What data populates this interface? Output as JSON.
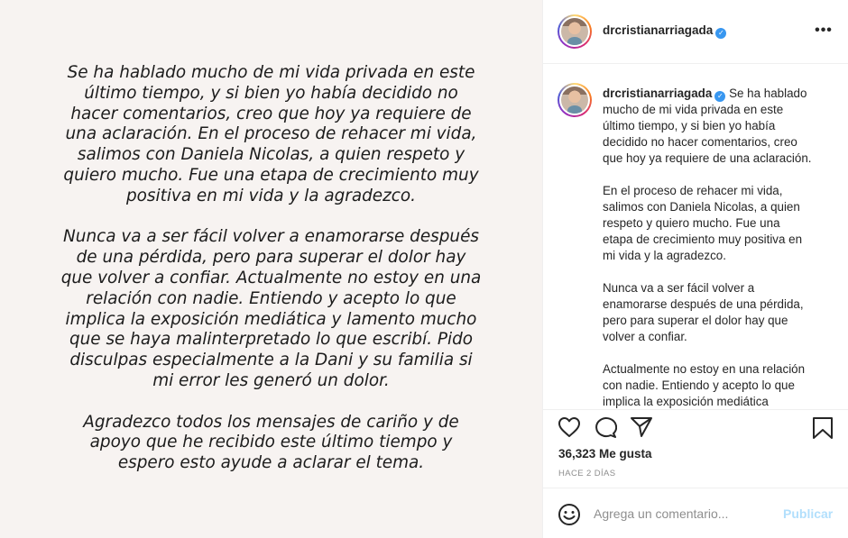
{
  "post_image": {
    "paragraphs": [
      [
        "Se ha hablado mucho de mi vida privada en este",
        "último tiempo, y si bien yo había decidido no",
        "hacer comentarios, creo que hoy ya requiere de",
        "una aclaración. En el proceso de rehacer mi vida,",
        "salimos con Daniela Nicolas, a quien respeto y",
        "quiero mucho. Fue una etapa de crecimiento muy",
        "positiva en mi vida y la agradezco."
      ],
      [
        "Nunca va a ser fácil volver a enamorarse después",
        "de una pérdida, pero para superar el dolor hay",
        "que volver a confiar. Actualmente no estoy en una",
        "relación con nadie. Entiendo y acepto lo que",
        "implica la exposición mediática y lamento mucho",
        "que se haya malinterpretado lo que escribí. Pido",
        "disculpas especialmente a la Dani y su familia si",
        "mi error les generó un dolor."
      ],
      [
        "Agradezco todos los mensajes de cariño y de",
        "apoyo que he recibido este último tiempo y",
        "espero esto ayude a aclarar el tema."
      ]
    ]
  },
  "header": {
    "username": "drcristianarriagada",
    "verified_icon": "verified-badge-icon",
    "more_label": "•••"
  },
  "caption": {
    "username": "drcristianarriagada",
    "first_line_rest": "Se ha hablado",
    "paragraphs": [
      [
        "mucho de mi vida privada en este",
        "último tiempo, y si bien yo había",
        "decidido no hacer comentarios, creo",
        "que hoy ya requiere de una aclaración."
      ],
      [
        "En el proceso de rehacer mi vida,",
        "salimos con Daniela Nicolas, a quien",
        "respeto y quiero mucho. Fue una",
        "etapa de crecimiento muy positiva en",
        "mi vida y la agradezco."
      ],
      [
        "Nunca va a ser fácil volver a",
        "enamorarse después de una pérdida,",
        "pero para superar el dolor hay que",
        "volver a confiar."
      ],
      [
        "Actualmente no estoy en una relación",
        "con nadie. Entiendo y acepto lo que",
        "implica la exposición mediática"
      ]
    ]
  },
  "actions": {
    "icons": [
      "heart-icon",
      "comment-icon",
      "share-icon",
      "bookmark-icon"
    ],
    "likes": "36,323 Me gusta",
    "timestamp": "HACE 2 DÍAS"
  },
  "comment": {
    "emoji_icon": "emoji-icon",
    "placeholder": "Agrega un comentario...",
    "publish_label": "Publicar"
  },
  "colors": {
    "post_background": "#f7f3f1",
    "verified": "#3897f0",
    "publish_disabled": "#b2dffc",
    "muted": "#8e8e8e",
    "border": "#efefef"
  }
}
